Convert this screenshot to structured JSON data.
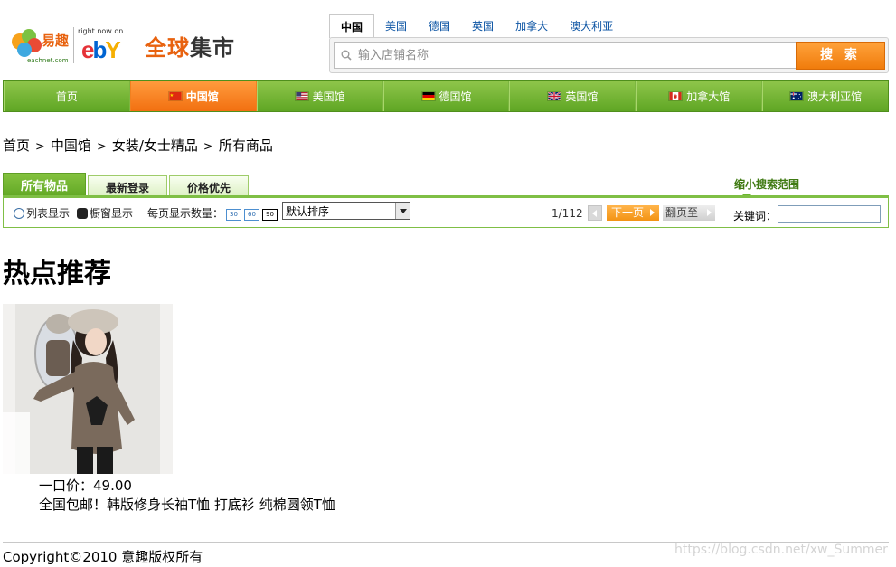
{
  "header": {
    "eachnet_logo_text": "易趣",
    "eachnet_logo_subtext": "eachnet.com",
    "ebay_tagline": "right now on",
    "ebay_word": "ebY",
    "brand_title_orange": "全球",
    "brand_title_dark": "集市",
    "country_tabs": [
      "中国",
      "美国",
      "德国",
      "英国",
      "加拿大",
      "澳大利亚"
    ],
    "search_placeholder": "输入店铺名称",
    "search_button": "搜 索"
  },
  "nav": {
    "items": [
      "首页",
      "中国馆",
      "美国馆",
      "德国馆",
      "英国馆",
      "加拿大馆",
      "澳大利亚馆"
    ]
  },
  "breadcrumb": [
    "首页",
    "中国馆",
    "女装/女士精品",
    "所有商品"
  ],
  "breadcrumb_separator": ">",
  "filter_tabs": [
    "所有物品",
    "最新登录",
    "价格优先"
  ],
  "narrow_search": "缩小搜索范围",
  "toolbar": {
    "list_view": "列表显示",
    "gallery_view": "橱窗显示",
    "per_page_label": "每页显示数量：",
    "per_page_options": [
      "30",
      "60",
      "90"
    ],
    "sort_value": "默认排序",
    "page_indicator": "1/112",
    "next_page": "下一页",
    "jump_to": "翻页至",
    "keyword_label": "关键词："
  },
  "hot": {
    "title": "热点推荐",
    "price_label": "一口价：",
    "price": "49.00",
    "description": "全国包邮！韩版修身长袖T恤 打底衫 纯棉圆领T恤"
  },
  "footer": {
    "copyright": "Copyright©2010 意趣版权所有",
    "watermark": "https://blog.csdn.net/xw_Summer"
  },
  "colors": {
    "nav_green": "#6fb532",
    "accent_orange": "#f07c0c",
    "link_blue": "#0d55a4"
  }
}
